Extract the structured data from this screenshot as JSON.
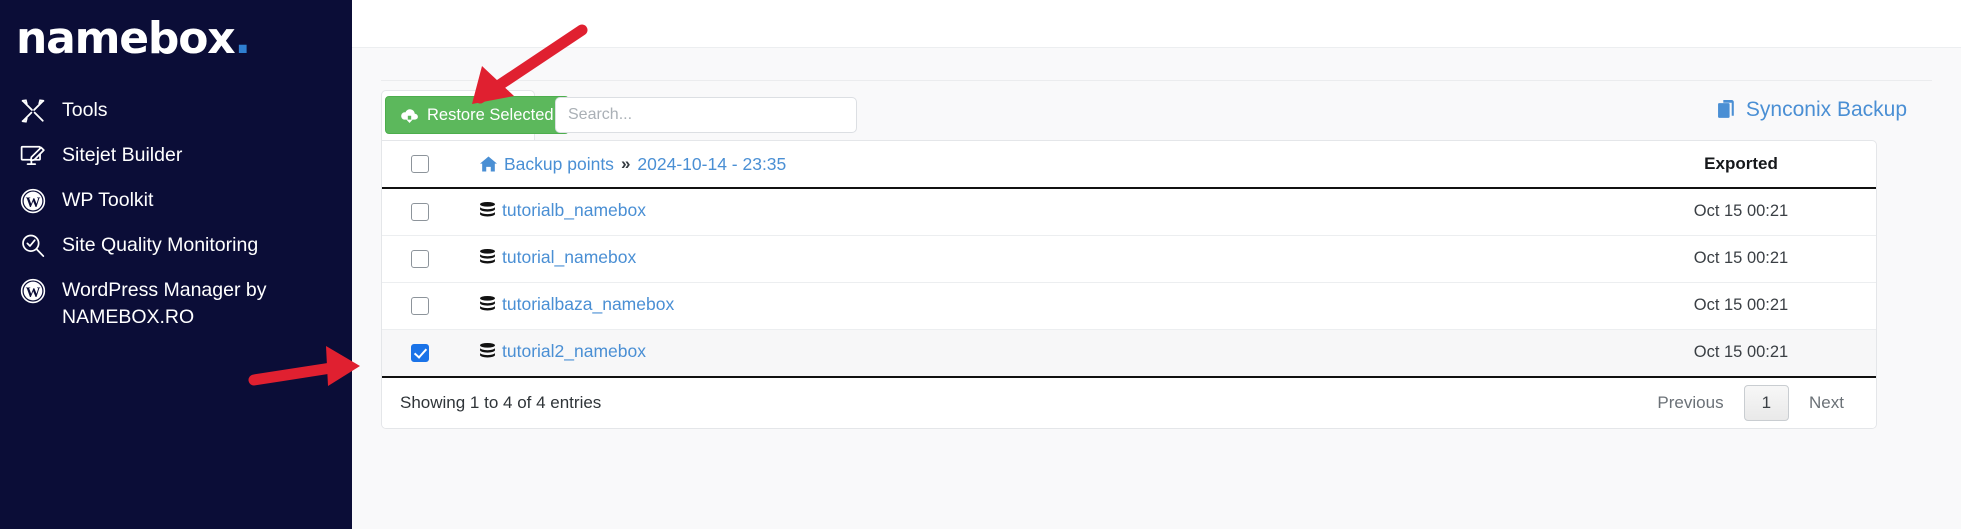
{
  "sidebar": {
    "brand": {
      "name": "namebox",
      "dot": "."
    },
    "items": [
      {
        "label": "Tools",
        "icon": "tools-icon"
      },
      {
        "label": "Sitejet Builder",
        "icon": "monitor-pen-icon"
      },
      {
        "label": "WP Toolkit",
        "icon": "wordpress-icon"
      },
      {
        "label": "Site Quality Monitoring",
        "icon": "magnifier-check-icon"
      },
      {
        "label": "WordPress Manager by NAMEBOX.RO",
        "icon": "wordpress-icon"
      }
    ]
  },
  "toolbar": {
    "restore_label": "Restore Selected",
    "restore_icon": "cloud-download-icon",
    "search_placeholder": "Search...",
    "search_value": "",
    "synconix_label": "Synconix Backup",
    "synconix_icon": "copy-files-icon"
  },
  "table": {
    "header": {
      "breadcrumb_root": "Backup points",
      "breadcrumb_separator": "»",
      "breadcrumb_current": "2024-10-14 - 23:35",
      "home_icon": "home-icon",
      "exported_label": "Exported",
      "select_all_checked": false
    },
    "rows": [
      {
        "name": "tutorialb_namebox",
        "exported": "Oct 15 00:21",
        "checked": false,
        "icon": "database-icon"
      },
      {
        "name": "tutorial_namebox",
        "exported": "Oct 15 00:21",
        "checked": false,
        "icon": "database-icon"
      },
      {
        "name": "tutorialbaza_namebox",
        "exported": "Oct 15 00:21",
        "checked": false,
        "icon": "database-icon"
      },
      {
        "name": "tutorial2_namebox",
        "exported": "Oct 15 00:21",
        "checked": true,
        "icon": "database-icon"
      }
    ]
  },
  "footer": {
    "showing": "Showing 1 to 4 of 4 entries",
    "previous": "Previous",
    "page": "1",
    "next": "Next"
  },
  "colors": {
    "sidebar_bg": "#0b0d37",
    "brand_dot": "#2f7fd1",
    "link_blue": "#4a8fd4",
    "button_green": "#5cb85c",
    "checkbox_blue": "#1a73e8",
    "annotation_red": "#e02030",
    "content_bg": "#f9f9fa"
  }
}
